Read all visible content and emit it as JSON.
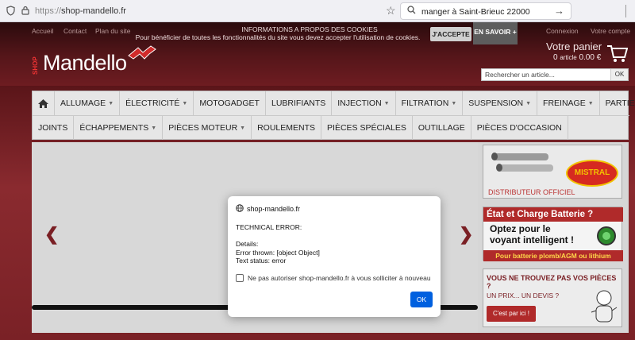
{
  "browser": {
    "url_scheme": "https://",
    "url_host": "shop-mandello.fr",
    "search_query": "manger à Saint-Brieuc 22000"
  },
  "site": {
    "top_links": [
      "Accueil",
      "Contact",
      "Plan du site"
    ],
    "top_links_right": [
      "Connexion",
      "Votre compte"
    ],
    "cookie_title": "INFORMATIONS A PROPOS DES COOKIES",
    "cookie_text": "Pour bénéficier de toutes les fonctionnalités du site vous devez accepter l'utilisation de cookies.",
    "accept_label": "J'ACCEPTE",
    "more_label": "EN SAVOIR +",
    "logo_shop": "SHOP",
    "logo_name": "Mandello",
    "cart_title": "Votre panier",
    "cart_count": "0",
    "cart_unit": "article",
    "cart_total": "0.00 €",
    "search_placeholder": "Rechercher un article...",
    "search_ok": "OK"
  },
  "nav": {
    "row1": [
      {
        "label": "ALLUMAGE",
        "dropdown": true
      },
      {
        "label": "ÉLECTRICITÉ",
        "dropdown": true
      },
      {
        "label": "MOTOGADGET",
        "dropdown": false
      },
      {
        "label": "LUBRIFIANTS",
        "dropdown": false
      },
      {
        "label": "INJECTION",
        "dropdown": true
      },
      {
        "label": "FILTRATION",
        "dropdown": true
      },
      {
        "label": "SUSPENSION",
        "dropdown": true
      },
      {
        "label": "FREINAGE",
        "dropdown": true
      },
      {
        "label": "PARTIE CYCLE",
        "dropdown": true
      }
    ],
    "row2": [
      {
        "label": "JOINTS",
        "dropdown": false
      },
      {
        "label": "ÉCHAPPEMENTS",
        "dropdown": true
      },
      {
        "label": "PIÈCES MOTEUR",
        "dropdown": true
      },
      {
        "label": "ROULEMENTS",
        "dropdown": false
      },
      {
        "label": "PIÈCES SPÉCIALES",
        "dropdown": false
      },
      {
        "label": "OUTILLAGE",
        "dropdown": false
      },
      {
        "label": "PIÈCES D'OCCASION",
        "dropdown": false
      }
    ]
  },
  "ads": {
    "mistral_logo": "MISTRAL",
    "distributor": "DISTRIBUTEUR OFFICIEL",
    "battery_title": "État et Charge Batterie ?",
    "battery_line1": "Optez pour le",
    "battery_line2": "voyant intelligent !",
    "battery_footer": "Pour batterie plomb/AGM ou lithium",
    "parts_title": "VOUS NE TROUVEZ PAS VOS PIÈCES ?",
    "parts_sub": "UN PRIX... UN DEVIS ?",
    "parts_button": "C'est par ici !"
  },
  "dialog": {
    "origin": "shop-mandello.fr",
    "message": "TECHNICAL ERROR:\n\nDetails:\nError thrown: [object Object]\nText status: error",
    "checkbox_label": "Ne pas autoriser shop-mandello.fr à vous solliciter à nouveau",
    "ok_label": "OK"
  }
}
